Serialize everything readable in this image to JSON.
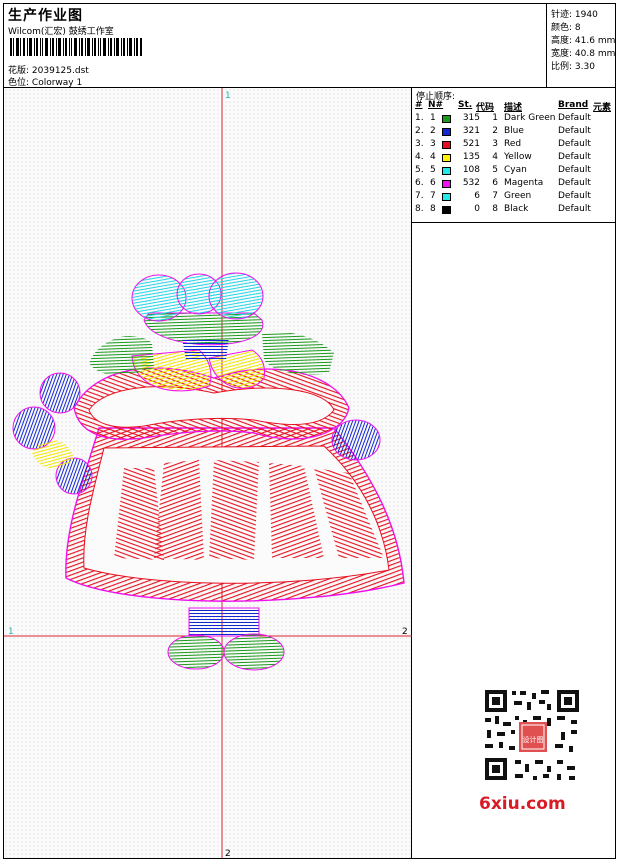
{
  "header": {
    "title": "生产作业图",
    "subtitle": "Wilcom(汇宏) 鼓绣工作室",
    "design_label": "花版:",
    "design_value": "2039125.dst",
    "colorway_label": "色位:",
    "colorway_value": "Colorway 1"
  },
  "stats": [
    {
      "label": "针迹:",
      "value": "1940"
    },
    {
      "label": "颜色:",
      "value": "8"
    },
    {
      "label": "高度:",
      "value": "41.6 mm"
    },
    {
      "label": "宽度:",
      "value": "40.8 mm"
    },
    {
      "label": "比例:",
      "value": "3.30"
    }
  ],
  "canvas": {
    "axis_marks": {
      "top": "1",
      "left": "1",
      "right": "2",
      "bottom": "2"
    }
  },
  "sequence": {
    "title": "停止顺序:",
    "columns": [
      "#",
      "N#",
      "St.",
      "代码",
      "描述",
      "Brand",
      "元素"
    ],
    "rows": [
      {
        "n": "1.",
        "nn": "1",
        "color": "#1a9a1a",
        "st": "315",
        "code": "1",
        "desc": "Dark Green",
        "brand": "Default"
      },
      {
        "n": "2.",
        "nn": "2",
        "color": "#1428d2",
        "st": "321",
        "code": "2",
        "desc": "Blue",
        "brand": "Default"
      },
      {
        "n": "3.",
        "nn": "3",
        "color": "#e8101e",
        "st": "521",
        "code": "3",
        "desc": "Red",
        "brand": "Default"
      },
      {
        "n": "4.",
        "nn": "4",
        "color": "#fff200",
        "st": "135",
        "code": "4",
        "desc": "Yellow",
        "brand": "Default"
      },
      {
        "n": "5.",
        "nn": "5",
        "color": "#24e8e8",
        "st": "108",
        "code": "5",
        "desc": "Cyan",
        "brand": "Default"
      },
      {
        "n": "6.",
        "nn": "6",
        "color": "#ee10ee",
        "st": "532",
        "code": "6",
        "desc": "Magenta",
        "brand": "Default"
      },
      {
        "n": "7.",
        "nn": "7",
        "color": "#24e8e8",
        "st": "6",
        "code": "7",
        "desc": "Green",
        "brand": "Default"
      },
      {
        "n": "8.",
        "nn": "8",
        "color": "#000000",
        "st": "0",
        "code": "8",
        "desc": "Black",
        "brand": "Default"
      }
    ]
  },
  "watermark": {
    "site": "6xiu.com",
    "stamp": "设计图"
  },
  "colors": {
    "guide": "#d8262e",
    "axis_mark": "#1fb4b4",
    "border": "#000000"
  }
}
